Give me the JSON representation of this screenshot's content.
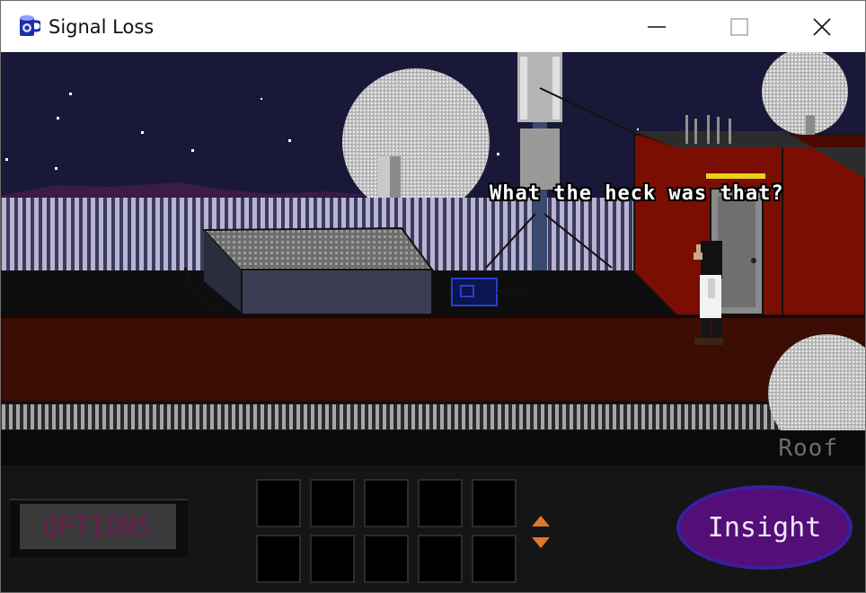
{
  "window": {
    "title": "Signal Loss",
    "app_icon": "blue-mug-icon",
    "controls": [
      "minimize-icon",
      "maximize-icon",
      "close-icon"
    ]
  },
  "scene": {
    "dialogue": "What the heck was that?",
    "location": "Roof"
  },
  "hud": {
    "options_label": "OPTIONS",
    "insight_label": "Insight",
    "inventory_slot_count": 10,
    "scroll_icons": [
      "arrow-up-icon",
      "arrow-down-icon"
    ]
  },
  "colors": {
    "sky": "#1a1838",
    "roof_floor": "#3b0d05",
    "building_wall": "#7a0e02",
    "insight_button": "#540e78",
    "options_text": "#6b1b52",
    "scroll_arrows": "#e0782a"
  }
}
